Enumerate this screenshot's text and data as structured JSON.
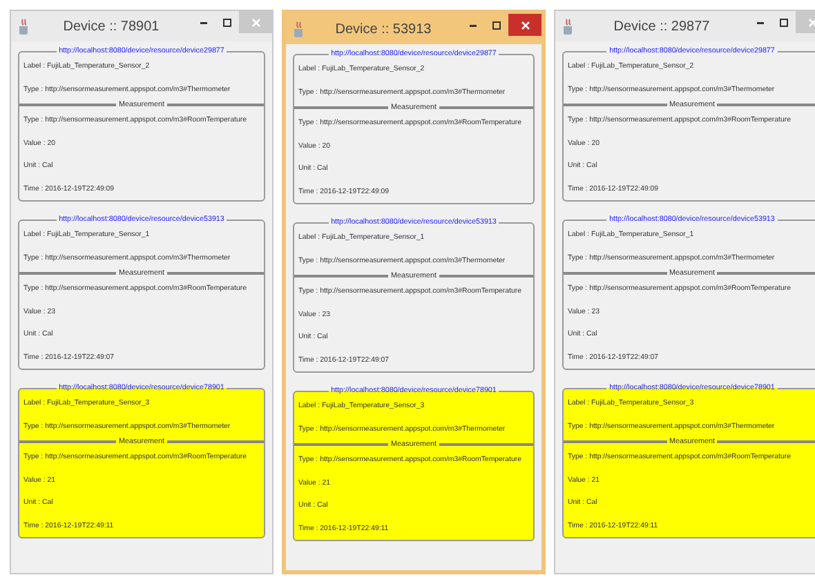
{
  "windows": [
    {
      "title": "Device :: 78901",
      "active": false,
      "devices": [
        {
          "url": "http://localhost:8080/device/resource/device29877",
          "label": "Label : FujiLab_Temperature_Sensor_2",
          "type": "Type : http://sensormeasurement.appspot.com/m3#Thermometer",
          "highlighted": false,
          "measurement": {
            "legend": "Measurement",
            "type": "Type : http://sensormeasurement.appspot.com/m3#RoomTemperature",
            "value": "Value : 20",
            "unit": "Unit : Cal",
            "time": "Time : 2016-12-19T22:49:09"
          }
        },
        {
          "url": "http://localhost:8080/device/resource/device53913",
          "label": "Label : FujiLab_Temperature_Sensor_1",
          "type": "Type : http://sensormeasurement.appspot.com/m3#Thermometer",
          "highlighted": false,
          "measurement": {
            "legend": "Measurement",
            "type": "Type : http://sensormeasurement.appspot.com/m3#RoomTemperature",
            "value": "Value : 23",
            "unit": "Unit : Cal",
            "time": "Time : 2016-12-19T22:49:07"
          }
        },
        {
          "url": "http://localhost:8080/device/resource/device78901",
          "label": "Label : FujiLab_Temperature_Sensor_3",
          "type": "Type : http://sensormeasurement.appspot.com/m3#Thermometer",
          "highlighted": true,
          "measurement": {
            "legend": "Measurement",
            "type": "Type : http://sensormeasurement.appspot.com/m3#RoomTemperature",
            "value": "Value : 21",
            "unit": "Unit : Cal",
            "time": "Time : 2016-12-19T22:49:11"
          }
        }
      ]
    },
    {
      "title": "Device :: 53913",
      "active": true,
      "devices": [
        {
          "url": "http://localhost:8080/device/resource/device29877",
          "label": "Label : FujiLab_Temperature_Sensor_2",
          "type": "Type : http://sensormeasurement.appspot.com/m3#Thermometer",
          "highlighted": false,
          "measurement": {
            "legend": "Measurement",
            "type": "Type : http://sensormeasurement.appspot.com/m3#RoomTemperature",
            "value": "Value : 20",
            "unit": "Unit : Cal",
            "time": "Time : 2016-12-19T22:49:09"
          }
        },
        {
          "url": "http://localhost:8080/device/resource/device53913",
          "label": "Label : FujiLab_Temperature_Sensor_1",
          "type": "Type : http://sensormeasurement.appspot.com/m3#Thermometer",
          "highlighted": false,
          "measurement": {
            "legend": "Measurement",
            "type": "Type : http://sensormeasurement.appspot.com/m3#RoomTemperature",
            "value": "Value : 23",
            "unit": "Unit : Cal",
            "time": "Time : 2016-12-19T22:49:07"
          }
        },
        {
          "url": "http://localhost:8080/device/resource/device78901",
          "label": "Label : FujiLab_Temperature_Sensor_3",
          "type": "Type : http://sensormeasurement.appspot.com/m3#Thermometer",
          "highlighted": true,
          "measurement": {
            "legend": "Measurement",
            "type": "Type : http://sensormeasurement.appspot.com/m3#RoomTemperature",
            "value": "Value : 21",
            "unit": "Unit : Cal",
            "time": "Time : 2016-12-19T22:49:11"
          }
        }
      ]
    },
    {
      "title": "Device :: 29877",
      "active": false,
      "devices": [
        {
          "url": "http://localhost:8080/device/resource/device29877",
          "label": "Label : FujiLab_Temperature_Sensor_2",
          "type": "Type : http://sensormeasurement.appspot.com/m3#Thermometer",
          "highlighted": false,
          "measurement": {
            "legend": "Measurement",
            "type": "Type : http://sensormeasurement.appspot.com/m3#RoomTemperature",
            "value": "Value : 20",
            "unit": "Unit : Cal",
            "time": "Time : 2016-12-19T22:49:09"
          }
        },
        {
          "url": "http://localhost:8080/device/resource/device53913",
          "label": "Label : FujiLab_Temperature_Sensor_1",
          "type": "Type : http://sensormeasurement.appspot.com/m3#Thermometer",
          "highlighted": false,
          "measurement": {
            "legend": "Measurement",
            "type": "Type : http://sensormeasurement.appspot.com/m3#RoomTemperature",
            "value": "Value : 23",
            "unit": "Unit : Cal",
            "time": "Time : 2016-12-19T22:49:07"
          }
        },
        {
          "url": "http://localhost:8080/device/resource/device78901",
          "label": "Label : FujiLab_Temperature_Sensor_3",
          "type": "Type : http://sensormeasurement.appspot.com/m3#Thermometer",
          "highlighted": true,
          "measurement": {
            "legend": "Measurement",
            "type": "Type : http://sensormeasurement.appspot.com/m3#RoomTemperature",
            "value": "Value : 21",
            "unit": "Unit : Cal",
            "time": "Time : 2016-12-19T22:49:11"
          }
        }
      ]
    }
  ]
}
